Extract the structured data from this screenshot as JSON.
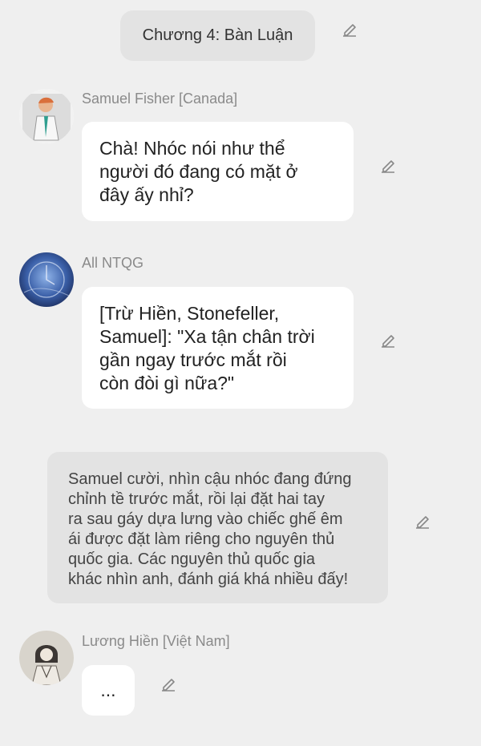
{
  "chapter": {
    "title": "Chương 4: Bàn Luận"
  },
  "messages": [
    {
      "author": "Samuel Fisher [Canada]",
      "lines": [
        "Chà! Nhóc nói như thể",
        "người đó đang có mặt ở",
        "đây ấy nhỉ?"
      ]
    },
    {
      "author": "All NTQG",
      "lines": [
        "[Trừ Hiền, Stonefeller,",
        "Samuel]: \"Xa tận chân trời",
        "gần ngay trước mắt rồi",
        "còn đòi gì nữa?\""
      ]
    },
    {
      "author": "Lương Hiền [Việt Nam]",
      "lines": [
        "..."
      ]
    }
  ],
  "narration": {
    "lines": [
      "Samuel cười, nhìn cậu nhóc đang đứng",
      "chỉnh tề trước mắt, rồi lại đặt hai tay",
      "ra sau gáy dựa lưng vào chiếc ghế êm",
      "ái được đặt làm riêng cho nguyên thủ",
      "quốc gia. Các nguyên thủ quốc gia",
      "khác nhìn anh, đánh giá khá nhiều đấy!"
    ]
  },
  "icons": {
    "edit": "pencil-icon"
  },
  "colors": {
    "background": "#efefef",
    "bubble": "#ffffff",
    "pill": "#e3e3e3",
    "name": "#8a8a8a"
  }
}
